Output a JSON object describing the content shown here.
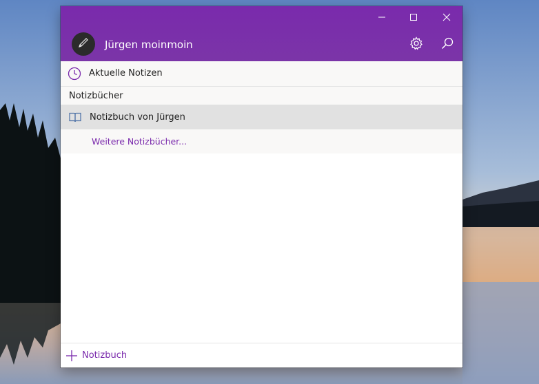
{
  "window": {
    "controls": {
      "minimize_icon": "minimize-icon",
      "maximize_icon": "maximize-icon",
      "close_icon": "close-icon"
    }
  },
  "header": {
    "username": "Jürgen moinmoin",
    "avatar_icon": "pen-icon",
    "settings_icon": "gear-icon",
    "search_icon": "search-icon"
  },
  "recent": {
    "icon": "clock-icon",
    "label": "Aktuelle Notizen"
  },
  "notebooks": {
    "section_label": "Notizbücher",
    "items": [
      {
        "icon": "book-icon",
        "label": "Notizbuch von Jürgen",
        "selected": true
      }
    ],
    "more_link": "Weitere Notizbücher..."
  },
  "footer": {
    "add_icon": "plus-icon",
    "add_label": "Notizbuch"
  },
  "colors": {
    "accent": "#7a2aac",
    "titlebar": "#7b2fa9",
    "selected_row": "#e1e1e1",
    "list_bg": "#f9f8f7"
  }
}
